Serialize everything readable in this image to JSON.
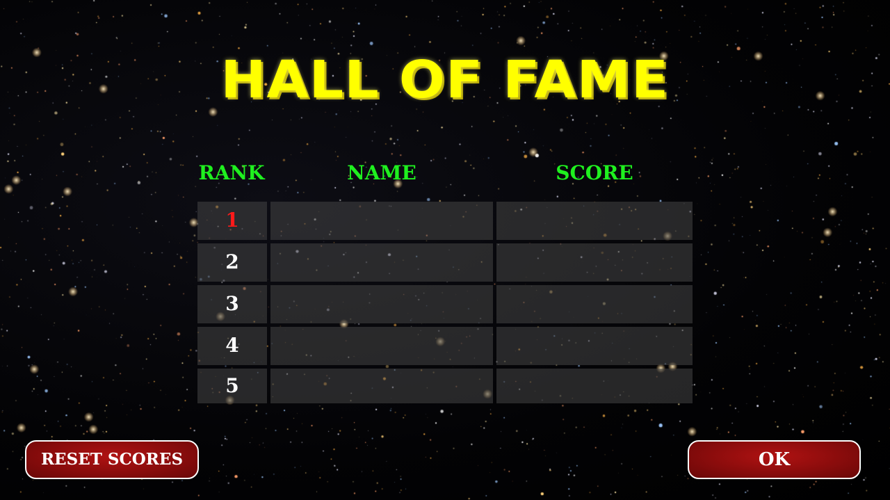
{
  "title": "HALL OF FAME",
  "headers": {
    "rank": "RANK",
    "name": "NAME",
    "score": "SCORE"
  },
  "rows": [
    {
      "rank": "1",
      "name": "",
      "score": ""
    },
    {
      "rank": "2",
      "name": "",
      "score": ""
    },
    {
      "rank": "3",
      "name": "",
      "score": ""
    },
    {
      "rank": "4",
      "name": "",
      "score": ""
    },
    {
      "rank": "5",
      "name": "",
      "score": ""
    }
  ],
  "buttons": {
    "reset": "RESET SCORES",
    "ok": "OK"
  },
  "colors": {
    "title": "#ffff00",
    "header": "#1ff01f",
    "first_rank": "#ff1a1a",
    "button_fill": "#8a0c0c",
    "button_border": "#ffffff"
  }
}
